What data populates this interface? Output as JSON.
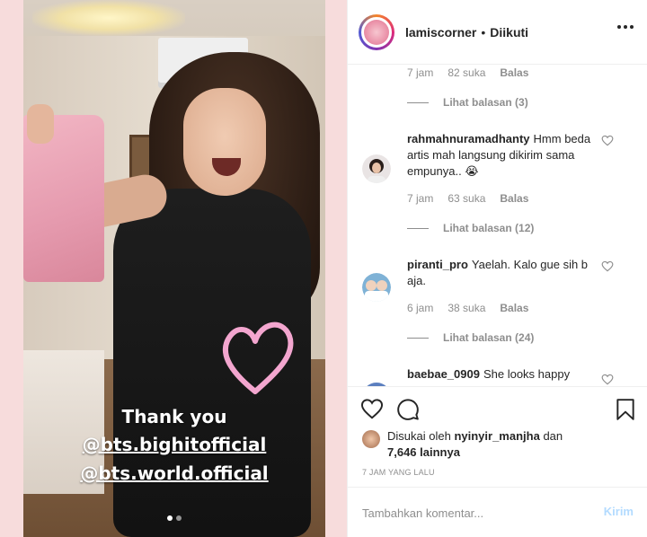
{
  "post": {
    "media": {
      "caption_lines": [
        "Thank you",
        "@bts.bighitofficial",
        "@bts.world.official"
      ]
    }
  },
  "header": {
    "username": "lamiscorner",
    "separator": "•",
    "follow_status": "Diikuti"
  },
  "comments": [
    {
      "meta_only": true,
      "time": "7 jam",
      "likes": "82 suka",
      "reply": "Balas",
      "view_replies": "Lihat balasan (3)"
    },
    {
      "username": "rahmahnuramadhanty",
      "text": "Hmm beda artis mah langsung dikirim sama empunya.. 😭",
      "time": "7 jam",
      "likes": "63 suka",
      "reply": "Balas",
      "view_replies": "Lihat balasan (12)"
    },
    {
      "username": "piranti_pro",
      "text": "Yaelah. Kalo gue sih b aja.",
      "time": "6 jam",
      "likes": "38 suka",
      "reply": "Balas",
      "view_replies": "Lihat balasan (24)"
    },
    {
      "username": "baebae_0909",
      "text": "She looks happy"
    }
  ],
  "likes": {
    "prefix": "Disukai oleh",
    "user": "nyinyir_manjha",
    "middle": "dan",
    "count": "7,646 lainnya"
  },
  "timestamp": "7 JAM YANG LALU",
  "composer": {
    "placeholder": "Tambahkan komentar...",
    "send_label": "Kirim"
  },
  "colors": {
    "media_bg": "#f7dcdc",
    "send_disabled": "#b3dbff",
    "muted_text": "#8e8e8e"
  },
  "icons": {
    "like": "heart-icon",
    "comment": "speech-bubble-icon",
    "save": "bookmark-icon",
    "more": "more-options-icon"
  }
}
